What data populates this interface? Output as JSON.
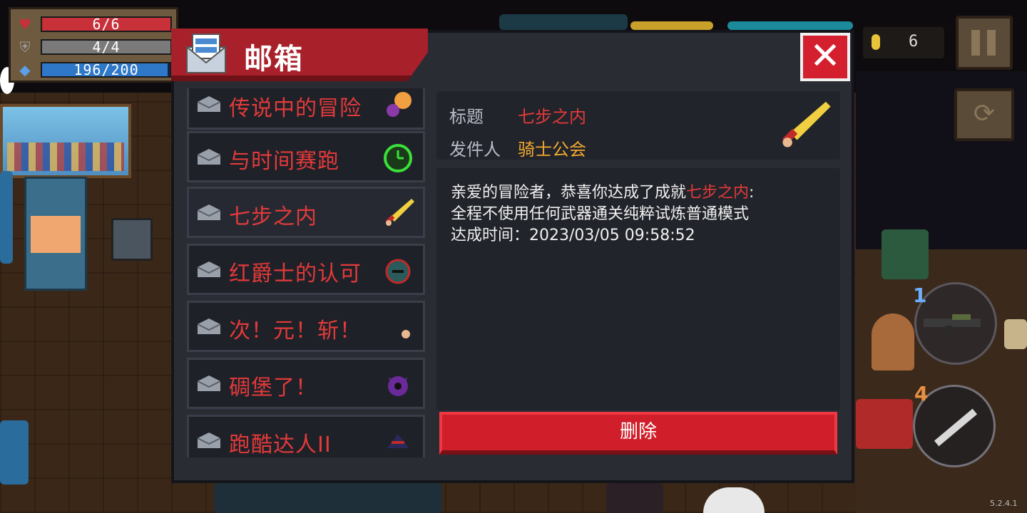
{
  "hud": {
    "hp": "6/6",
    "armor": "4/4",
    "energy": "196/200",
    "coins": "6",
    "colors": {
      "hp": "#c8303a",
      "armor": "#8a8a8a",
      "energy": "#2f78c8"
    }
  },
  "mailbox": {
    "title": "邮箱",
    "close_icon": "close-icon",
    "items": [
      {
        "name": "传说中的冒险",
        "icon": "hero-icon"
      },
      {
        "name": "与时间赛跑",
        "icon": "clock-icon"
      },
      {
        "name": "七步之内",
        "icon": "sword-icon",
        "active": true
      },
      {
        "name": "红爵士的认可",
        "icon": "helmet-icon"
      },
      {
        "name": "次！元！斩！",
        "icon": "crescent-blade-icon"
      },
      {
        "name": "碉堡了！",
        "icon": "purple-demon-icon"
      },
      {
        "name": "跑酷达人II",
        "icon": "ninja-icon"
      }
    ],
    "detail": {
      "title_label": "标题",
      "title_value": "七步之内",
      "sender_label": "发件人",
      "sender_value": "骑士公会",
      "line1_prefix": "亲爱的冒险者，恭喜你达成了成就",
      "line1_highlight": "七步之内",
      "line1_suffix": ":",
      "line2": "全程不使用任何武器通关纯粹试炼普通模式",
      "line3": "达成时间：2023/03/05 09:58:52"
    },
    "delete_label": "删除"
  },
  "weapon_slot": {
    "number": "1"
  },
  "skill_slot": {
    "number": "4"
  },
  "version": "5.2.4.1"
}
